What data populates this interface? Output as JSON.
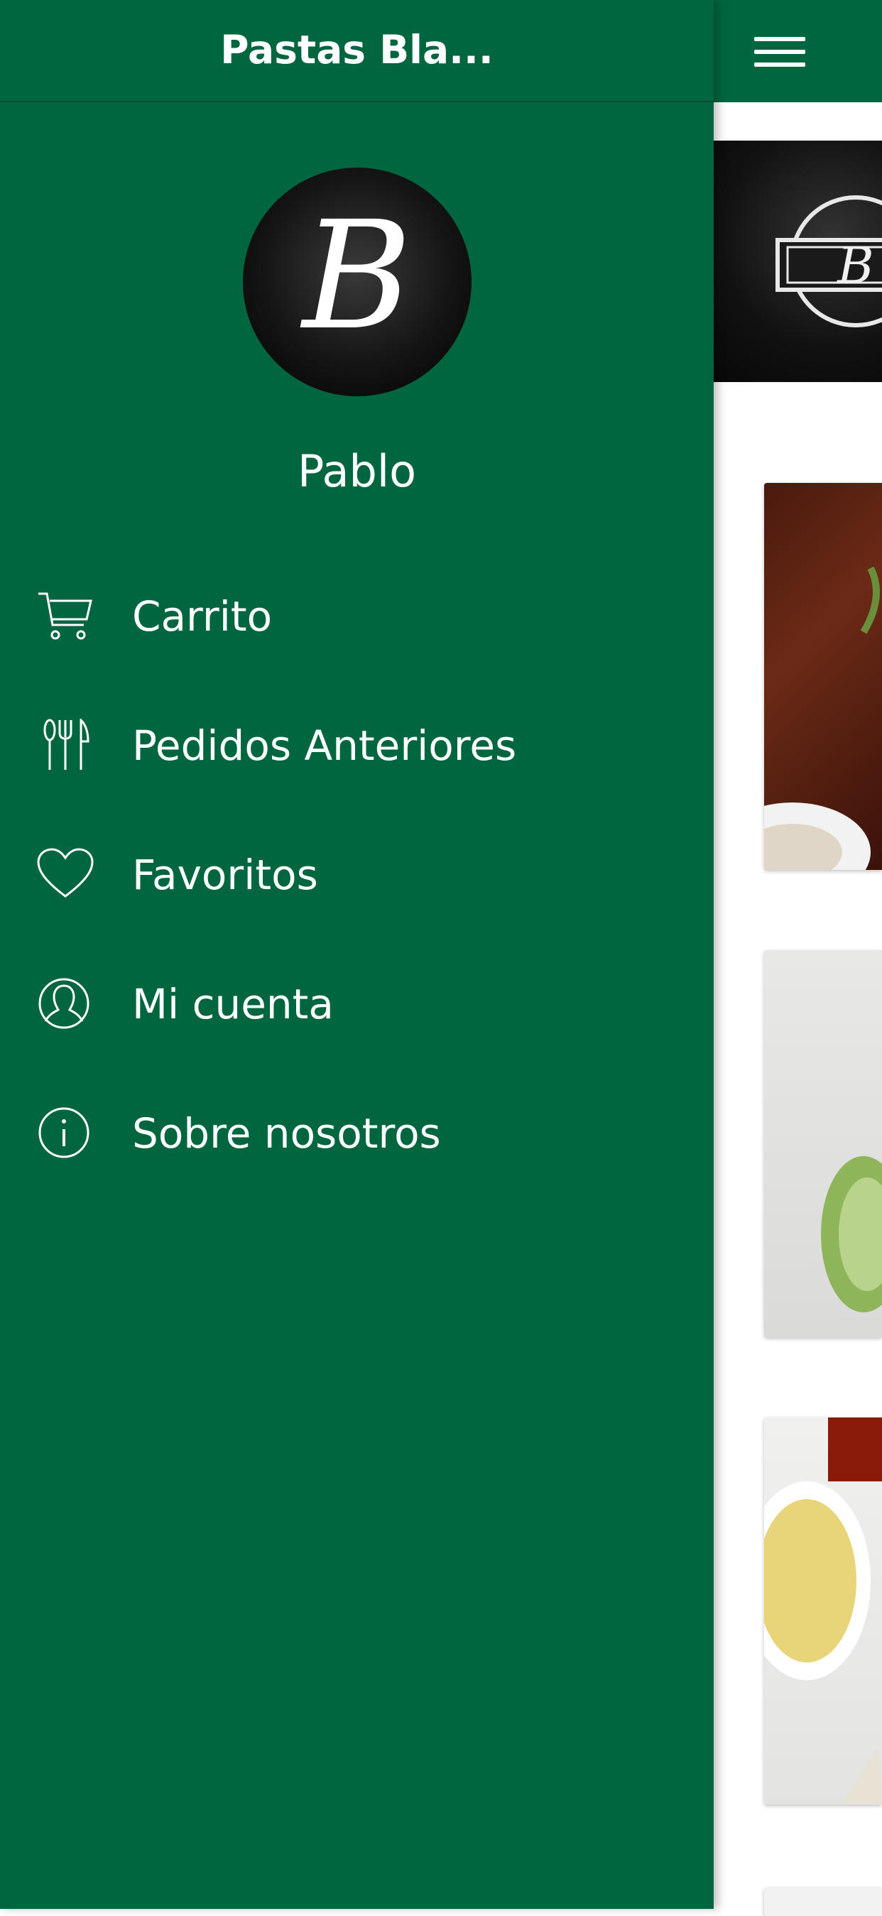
{
  "app": {
    "title": "Pastas Bla...",
    "accent_color": "#00663f",
    "avatar_monogram": "B"
  },
  "drawer": {
    "user_name": "Pablo",
    "items": [
      {
        "label": "Carrito",
        "icon": "cart-icon"
      },
      {
        "label": "Pedidos Anteriores",
        "icon": "utensils-icon"
      },
      {
        "label": "Favoritos",
        "icon": "heart-icon"
      },
      {
        "label": "Mi cuenta",
        "icon": "user-icon"
      },
      {
        "label": "Sobre nosotros",
        "icon": "info-icon"
      }
    ]
  },
  "main": {
    "menu_icon": "hamburger-icon",
    "banner_text": "B"
  }
}
